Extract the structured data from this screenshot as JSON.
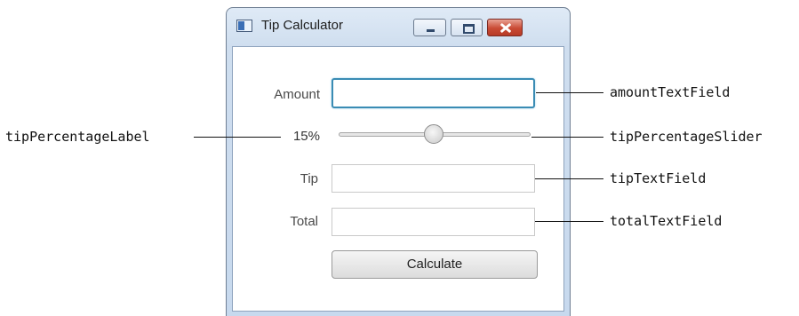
{
  "window": {
    "title": "Tip Calculator",
    "minimize": "minimize",
    "maximize": "maximize",
    "close": "close"
  },
  "form": {
    "amount_label": "Amount",
    "amount_value": "",
    "tip_percentage": "15%",
    "tip_label": "Tip",
    "tip_value": "",
    "total_label": "Total",
    "total_value": "",
    "calculate_label": "Calculate"
  },
  "slider": {
    "value": 15,
    "min": 0,
    "max": 30
  },
  "annotations": {
    "tip_percentage_label": "tipPercentageLabel",
    "amount_text_field": "amountTextField",
    "tip_percentage_slider": "tipPercentageSlider",
    "tip_text_field": "tipTextField",
    "total_text_field": "totalTextField"
  },
  "colors": {
    "focus_border": "#3a8cb4",
    "close_button": "#c94a34",
    "window_frame": "#cfdeef"
  }
}
